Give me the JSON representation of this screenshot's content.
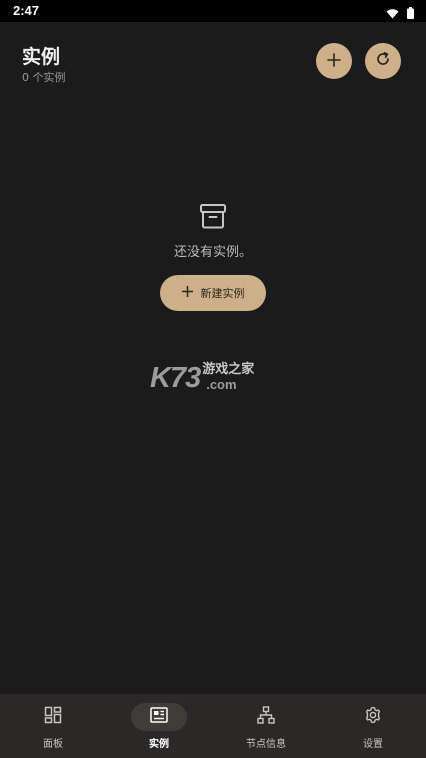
{
  "status_bar": {
    "time": "2:47"
  },
  "header": {
    "title": "实例",
    "subtitle": "0 个实例"
  },
  "empty_state": {
    "message": "还没有实例。",
    "new_button_label": "新建实例",
    "icon": "archive-icon"
  },
  "watermark": {
    "brand": "K73",
    "cn_text": "游戏之家",
    "domain": ".com"
  },
  "bottom_nav": {
    "items": [
      {
        "label": "面板",
        "icon": "dashboard-icon",
        "active": false
      },
      {
        "label": "实例",
        "icon": "instances-icon",
        "active": true
      },
      {
        "label": "节点信息",
        "icon": "node-tree-icon",
        "active": false
      },
      {
        "label": "设置",
        "icon": "gear-icon",
        "active": false
      }
    ]
  },
  "colors": {
    "background": "#1b1b1b",
    "accent": "#cdb08a",
    "nav_background": "#2a2927"
  }
}
